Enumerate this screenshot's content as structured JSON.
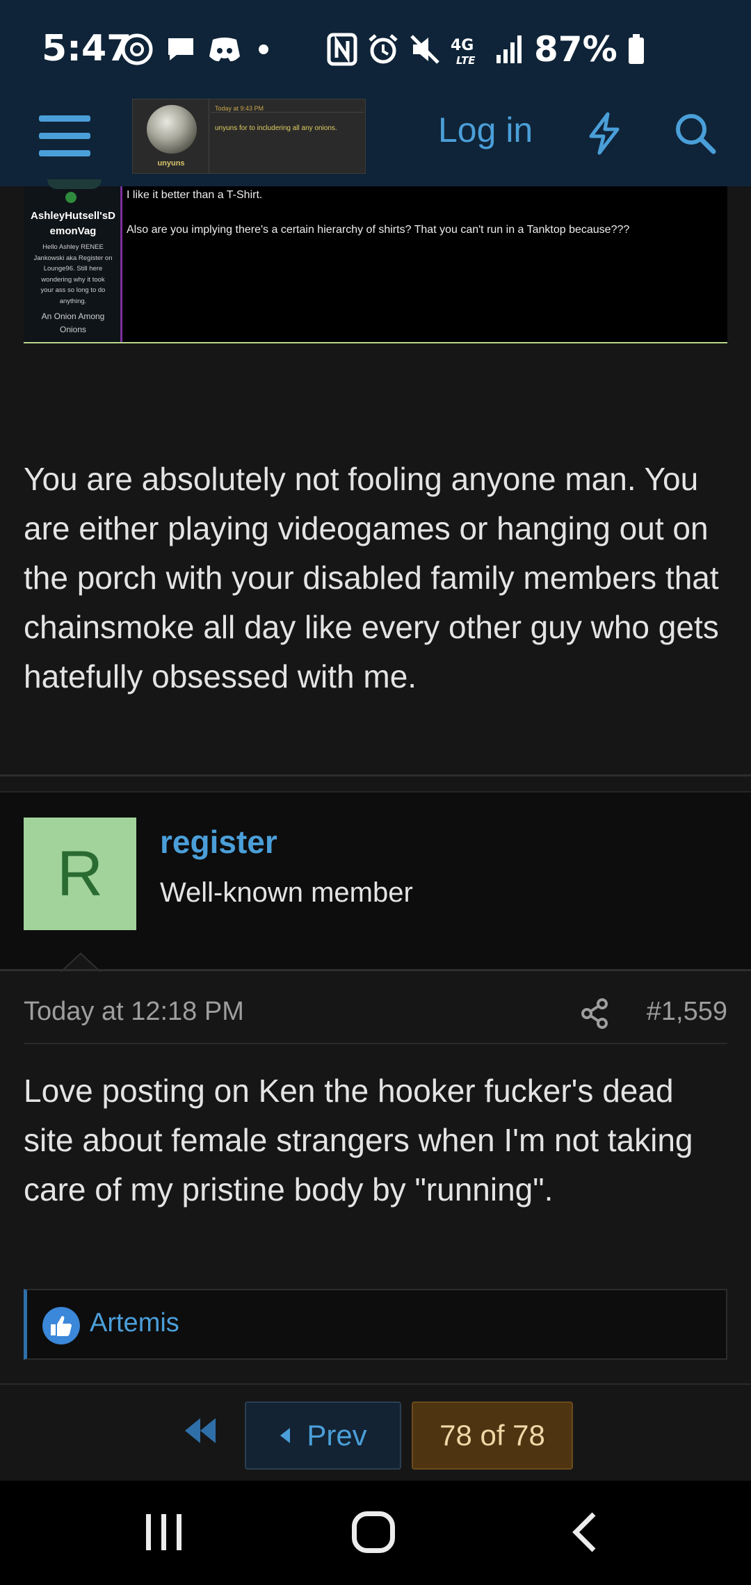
{
  "status_bar": {
    "time": "5:47",
    "network_label": "4G LTE",
    "battery": "87%",
    "icons": [
      "threads-icon",
      "chat-icon",
      "discord-icon",
      "dot-icon",
      "nfc-icon",
      "alarm-icon",
      "mute-icon",
      "network-icon",
      "signal-icon",
      "battery-icon"
    ]
  },
  "header": {
    "logo": {
      "name": "unyuns",
      "time": "Today at 9:43 PM",
      "message": "unyuns for to includering all any onions."
    },
    "login_label": "Log in",
    "icons": [
      "menu-icon",
      "bolt-icon",
      "search-icon"
    ],
    "accent": "#4b9fd9",
    "background": "#0f2438"
  },
  "quoted_post": {
    "username_line1": "AshleyHutsell'sD",
    "username_line2": "emonVag",
    "bio_lines": [
      "Hello Ashley RENEE",
      "Jankowski aka Register on",
      "Lounge96. Still here",
      "wondering why it took",
      "your ass so long to do",
      "anything."
    ],
    "title_lines": [
      "An Onion Among",
      "Onions"
    ],
    "line1": "I like it better than a T-Shirt.",
    "line2": "Also are you implying there's a certain hierarchy of shirts? That you can't run in a Tanktop because???"
  },
  "post1": {
    "body": "You are absolutely not fooling anyone man. You are either playing videogames or hanging out on the porch with your disabled family members that chainsmoke all day like every other guy who gets hatefully obsessed with me."
  },
  "post2": {
    "avatar_letter": "R",
    "avatar_color": "#a1d39a",
    "username": "register",
    "user_title": "Well-known member",
    "date": "Today at 12:18 PM",
    "post_number": "#1,559",
    "body": "Love posting on Ken the hooker fucker's dead site about female strangers when I'm not taking care of my pristine body by \"running\".",
    "reaction_user": "Artemis"
  },
  "pager": {
    "prev_label": "Prev",
    "page_label": "78 of 78"
  },
  "nav_bar": {
    "icons": [
      "recent-apps-icon",
      "home-icon",
      "back-icon"
    ]
  }
}
